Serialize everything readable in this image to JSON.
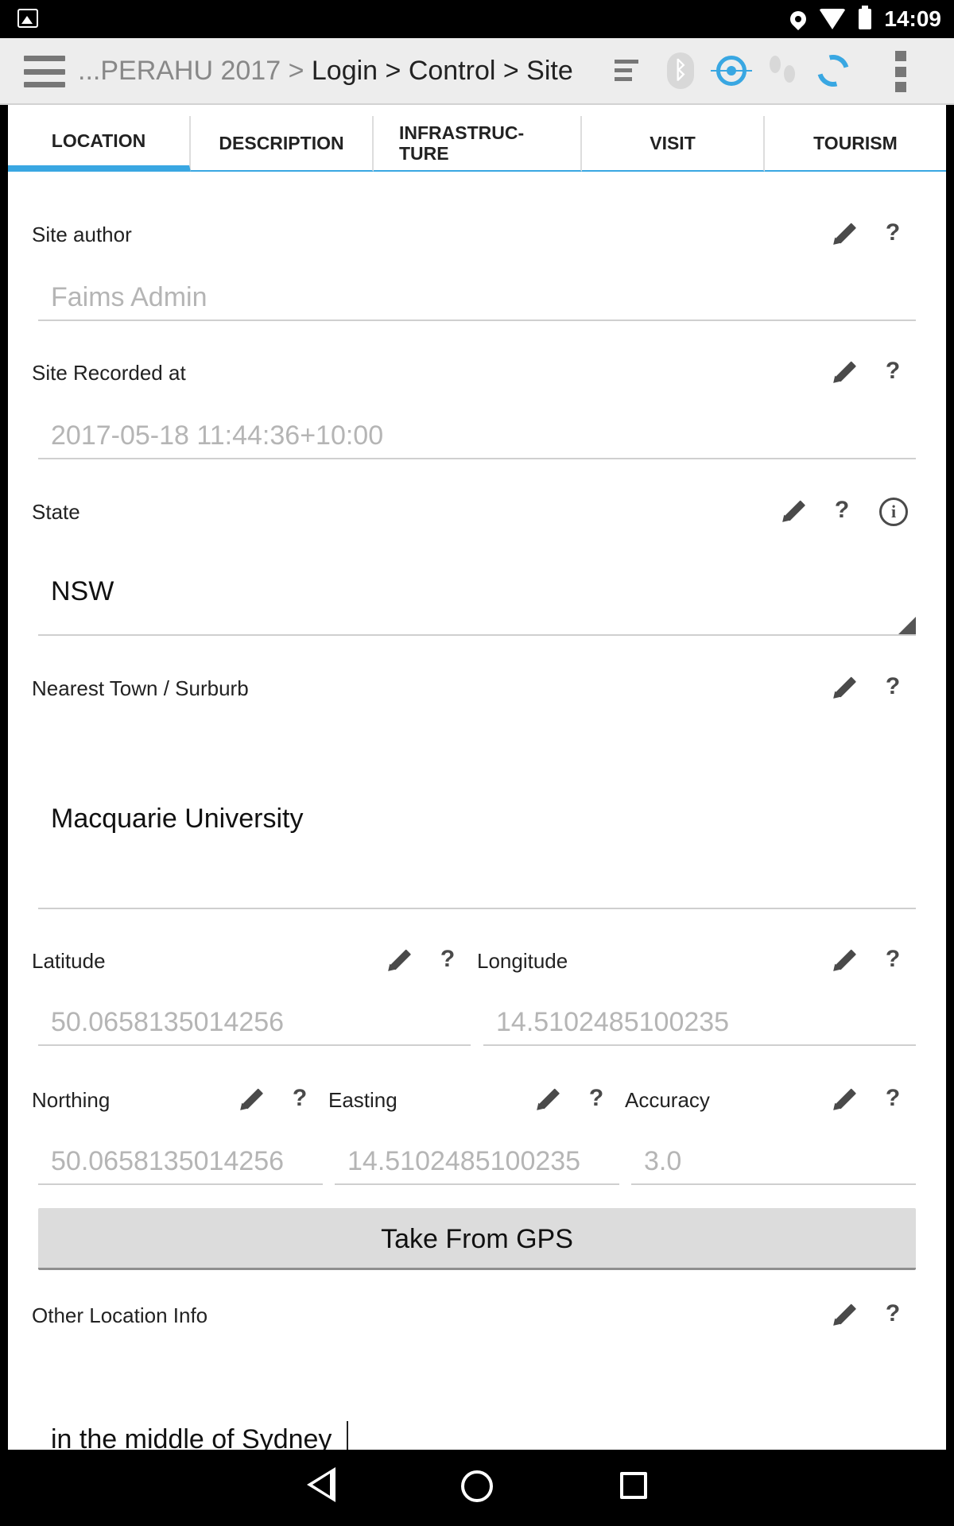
{
  "status": {
    "time": "14:09"
  },
  "toolbar": {
    "breadcrumb_prefix": "...PERAHU 2017 > ",
    "breadcrumb_rest": "Login > Control > Site",
    "bluetooth_glyph": "ᛒ",
    "icons": [
      "sync-list-icon",
      "bluetooth-icon",
      "gps-icon",
      "tracking-footsteps-icon",
      "refresh-icon",
      "overflow-menu-icon"
    ]
  },
  "tabs": [
    {
      "label": "LOCATION",
      "active": true
    },
    {
      "label": "DESCRIPTION"
    },
    {
      "label": "INFRASTRUC-\nTURE"
    },
    {
      "label": "VISIT"
    },
    {
      "label": "TOURISM"
    }
  ],
  "glyphs": {
    "help": "?",
    "info": "i"
  },
  "form": {
    "site_author": {
      "label": "Site author",
      "value": "Faims Admin"
    },
    "site_recorded_at": {
      "label": "Site Recorded at",
      "value": "2017-05-18 11:44:36+10:00"
    },
    "state": {
      "label": "State",
      "value": "NSW"
    },
    "nearest_town": {
      "label": "Nearest Town / Surburb",
      "value": "Macquarie University"
    },
    "latitude": {
      "label": "Latitude",
      "value": "50.0658135014256"
    },
    "longitude": {
      "label": "Longitude",
      "value": "14.5102485100235"
    },
    "northing": {
      "label": "Northing",
      "value": "50.0658135014256"
    },
    "easting": {
      "label": "Easting",
      "value": "14.5102485100235"
    },
    "accuracy": {
      "label": "Accuracy",
      "value": "3.0"
    },
    "take_from_gps": "Take From GPS",
    "other_location_info": {
      "label": "Other Location Info",
      "value": "in the middle of Sydney"
    }
  },
  "colors": {
    "accent": "#39a7e2",
    "toolbar_bg": "#ededed",
    "button_bg": "#dcdcdc"
  }
}
